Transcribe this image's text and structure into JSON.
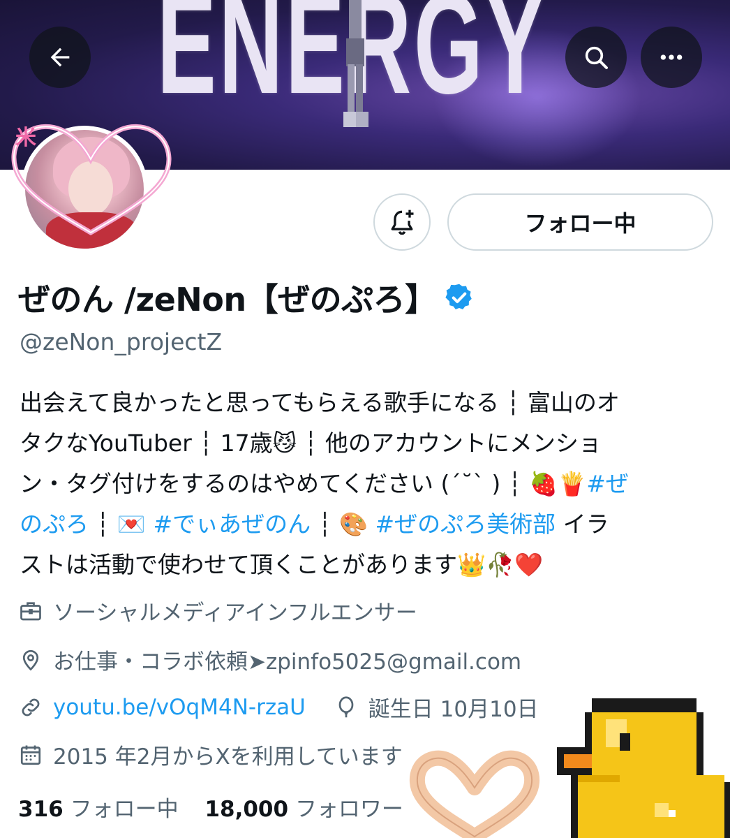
{
  "banner": {
    "text": "ENERGY",
    "back_label": "Back",
    "search_label": "Search",
    "more_label": "More"
  },
  "profile": {
    "avatar_badge": "米",
    "follow_button": "フォロー中",
    "display_name": "ぜのん /zeNon【ぜのぷろ】",
    "handle": "@zeNon_projectZ",
    "verified_icon": "verified-badge-icon"
  },
  "bio": {
    "line1": "出会えて良かったと思ってもらえる歌手になる ┆ 富山のオ",
    "line2": "タクなYouTuber ┆ 17歳😼 ┆ 他のアカウントにメンショ",
    "line3_text": "ン・タグ付けをするのはやめてください (ˊ˘ˋ ) ┆ 🍓🍟",
    "line3_tag": "#ぜ",
    "line4_tag1": "のぷろ",
    "line4_sep1": " ┆ 💌 ",
    "line4_tag2": "#でぃあぜのん",
    "line4_sep2": " ┆ 🎨 ",
    "line4_tag3": "#ぜのぷろ美術部",
    "line4_text": " イラ",
    "line5": "ストは活動で使わせて頂くことがあります👑🥀❤️"
  },
  "meta": {
    "category": "ソーシャルメディアインフルエンサー",
    "location": "お仕事・コラボ依頼➤zpinfo5025@gmail.com",
    "website": "youtu.be/vOqM4N-rzaU",
    "birthday": "誕生日  10月10日",
    "joined": "2015 年2月からXを利用しています"
  },
  "stats": {
    "following_count": "316",
    "following_label": "フォロー中",
    "followers_count": "18,000",
    "followers_label": "フォロワー"
  },
  "colors": {
    "accent": "#1d9bf0",
    "muted": "#536471",
    "text": "#0f1419",
    "border": "#cfd9de"
  }
}
